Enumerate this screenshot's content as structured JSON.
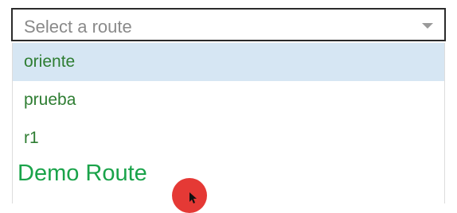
{
  "select": {
    "placeholder": "Select a route"
  },
  "options": [
    {
      "label": "oriente",
      "highlighted": true
    },
    {
      "label": "prueba",
      "highlighted": false
    },
    {
      "label": "r1",
      "highlighted": false
    }
  ],
  "demo_route_label": "Demo Route",
  "colors": {
    "option_text": "#2e7d32",
    "highlight": "#d6e6f3",
    "demo_text": "#1aa34a",
    "cursor_dot": "#e53935"
  }
}
